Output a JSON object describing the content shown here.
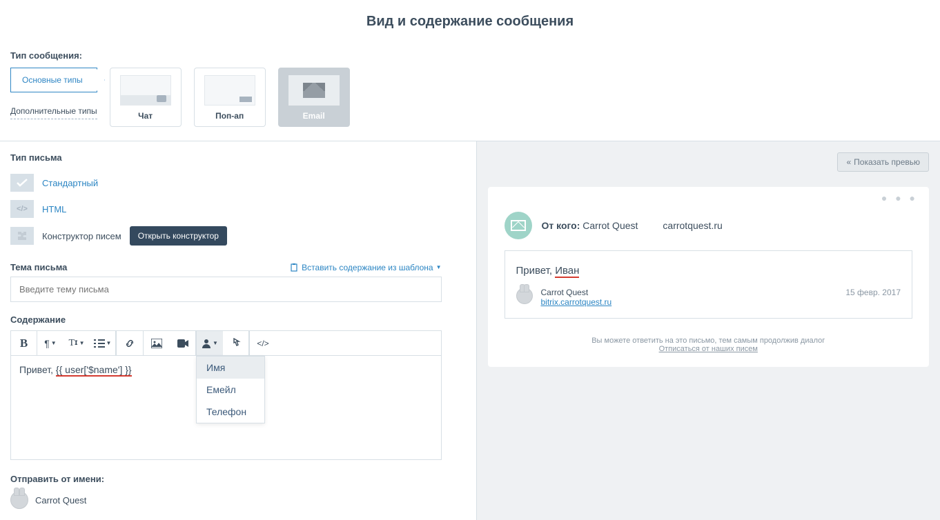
{
  "page_title": "Вид и содержание сообщения",
  "type_label": "Тип сообщения:",
  "side_types": {
    "main": "Основные типы",
    "extra": "Дополнительные типы"
  },
  "cards": {
    "chat": "Чат",
    "popup": "Поп-ап",
    "email": "Email"
  },
  "email_type": {
    "label": "Тип письма",
    "standard": "Стандартный",
    "html": "HTML",
    "constructor": "Конструктор писем",
    "open_constructor": "Открыть конструктор"
  },
  "subject": {
    "label": "Тема письма",
    "template_link": "Вставить содержание из шаблона",
    "placeholder": "Введите тему письма"
  },
  "content": {
    "label": "Содержание",
    "text_prefix": "Привет, ",
    "text_var": "{{ user['$name'] }}"
  },
  "dropdown": {
    "name": "Имя",
    "email": "Емейл",
    "phone": "Телефон"
  },
  "from": {
    "label": "Отправить от имени:",
    "name": "Carrot Quest"
  },
  "preview_btn": "Показать превью",
  "preview": {
    "from_label": "От кого:",
    "from_name": "Carrot Quest",
    "from_domain": "carrotquest.ru",
    "body_prefix": "Привет, ",
    "body_name": "Иван",
    "sig_name": "Carrot Quest",
    "sig_link": "bitrix.carrotquest.ru",
    "date": "15 февр. 2017",
    "footer_line": "Вы можете ответить на это письмо, тем самым продолжив диалог",
    "footer_link": "Отписаться от наших писем"
  }
}
